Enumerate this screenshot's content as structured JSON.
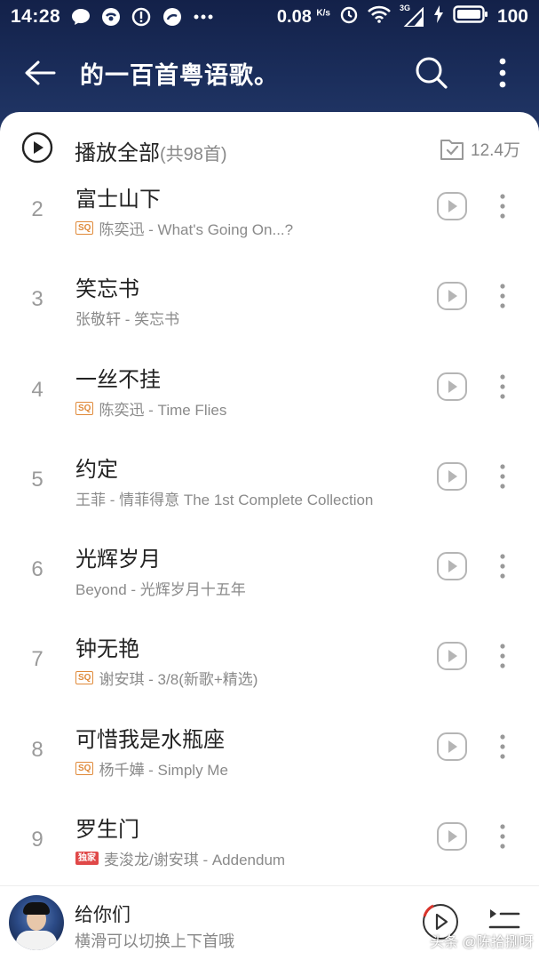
{
  "status_bar": {
    "time": "14:28",
    "net_speed": "0.08",
    "net_speed_unit": "K/s",
    "signal_label": "3G",
    "battery": "100",
    "icons": [
      "chat-bubble-icon",
      "app-icon",
      "alert-icon",
      "weibo-icon",
      "more-dots-icon",
      "alarm-icon",
      "wifi-icon",
      "signal-icon",
      "charging-icon",
      "battery-icon"
    ]
  },
  "header": {
    "title": "的一百首粤语歌。",
    "icons": [
      "back-arrow-icon",
      "search-icon",
      "more-vertical-icon"
    ]
  },
  "play_all": {
    "label": "播放全部",
    "count": "(共98首)",
    "favorites": "12.4万"
  },
  "songs": [
    {
      "num": "2",
      "title": "富士山下",
      "badge": "SQ",
      "subtitle": "陈奕迅 - What's Going On...?"
    },
    {
      "num": "3",
      "title": "笑忘书",
      "badge": "",
      "subtitle": "张敬轩 - 笑忘书"
    },
    {
      "num": "4",
      "title": "一丝不挂",
      "badge": "SQ",
      "subtitle": "陈奕迅 - Time Flies"
    },
    {
      "num": "5",
      "title": "约定",
      "badge": "",
      "subtitle": "王菲 - 情菲得意 The 1st Complete Collection"
    },
    {
      "num": "6",
      "title": "光辉岁月",
      "badge": "",
      "subtitle": "Beyond - 光辉岁月十五年"
    },
    {
      "num": "7",
      "title": "钟无艳",
      "badge": "SQ",
      "subtitle": "谢安琪 - 3/8(新歌+精选)"
    },
    {
      "num": "8",
      "title": "可惜我是水瓶座",
      "badge": "SQ",
      "subtitle": "杨千嬅 - Simply Me"
    },
    {
      "num": "9",
      "title": "罗生门",
      "badge": "独家",
      "subtitle": "麦浚龙/谢安琪 - Addendum"
    }
  ],
  "player": {
    "title": "给你们",
    "subtitle": "横滑可以切换上下首哦"
  },
  "watermark": "头条 @陈拾捌呀",
  "colors": {
    "header_bg": "#1b2e5c",
    "sq_badge": "#e08a3a",
    "exclusive_badge": "#e04848",
    "play_accent": "#d9342b"
  }
}
